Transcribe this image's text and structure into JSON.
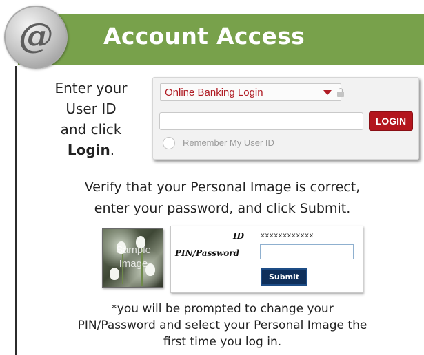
{
  "header": {
    "title": "Account Access",
    "at_symbol": "@",
    "bar_color": "#78a14b"
  },
  "step1": {
    "line1": "Enter your",
    "line2": "User ID",
    "line3": "and click",
    "login_word": "Login",
    "period": "."
  },
  "login_widget": {
    "select_value": "Online Banking Login",
    "userid_value": "",
    "login_label": "LOGIN",
    "remember_label": "Remember My User ID",
    "accent_color": "#b3151d"
  },
  "step2": {
    "line1": "Verify that your Personal Image is correct,",
    "line2": "enter your password, and click Submit."
  },
  "sample_image": {
    "line1": "Sample",
    "line2": "Image"
  },
  "pin_panel": {
    "id_label": "ID",
    "id_value": "xxxxxxxxxxxx",
    "pin_label": "PIN/Password",
    "pin_value": "",
    "submit_label": "Submit"
  },
  "footnote": {
    "line1": "*you will be prompted to change your",
    "line2": "PIN/Password and select your Personal Image the",
    "line3": "first time you log in."
  }
}
